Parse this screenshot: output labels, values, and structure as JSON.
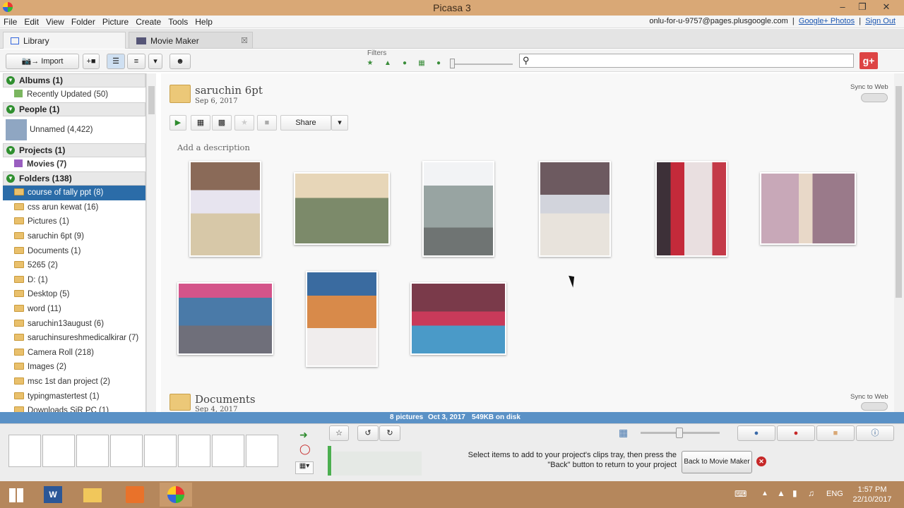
{
  "window": {
    "title": "Picasa 3"
  },
  "menu": [
    "File",
    "Edit",
    "View",
    "Folder",
    "Picture",
    "Create",
    "Tools",
    "Help"
  ],
  "account": {
    "email": "onlu-for-u-9757@pages.plusgoogle.com",
    "photos_link": "Google+ Photos",
    "signout": "Sign Out"
  },
  "tabs": {
    "library": "Library",
    "movie_maker": "Movie Maker"
  },
  "toolbar": {
    "import": "Import",
    "filters_label": "Filters"
  },
  "sidebar": {
    "albums": "Albums (1)",
    "recently_updated": "Recently Updated (50)",
    "people": "People (1)",
    "unnamed": "Unnamed (4,422)",
    "projects": "Projects (1)",
    "movies": "Movies (7)",
    "folders": "Folders (138)",
    "folder_items": [
      "course of tally ppt (8)",
      "css arun kewat (16)",
      "Pictures (1)",
      "saruchin 6pt (9)",
      "Documents (1)",
      "5265 (2)",
      "D: (1)",
      "Desktop (5)",
      "word (11)",
      "saruchin13august (6)",
      "saruchinsureshmedicalkirar (7)",
      "Camera Roll (218)",
      "Images (2)",
      "msc 1st dan project (2)",
      "typingmastertest (1)",
      "Downloads SiR PC (1)"
    ]
  },
  "album": {
    "title": "saruchin 6pt",
    "date": "Sep 6, 2017",
    "sync": "Sync to Web",
    "share": "Share",
    "description": "Add a description"
  },
  "next_album": {
    "title": "Documents",
    "date": "Sep 4, 2017",
    "sync": "Sync to Web"
  },
  "status": {
    "pictures": "8 pictures",
    "date": "Oct 3, 2017",
    "size": "549KB on disk"
  },
  "tray": {
    "message": "Select items to add to your project's clips tray, then press the \"Back\" button to return to your project",
    "back_button": "Back to Movie Maker"
  },
  "taskbar": {
    "lang": "ENG",
    "time": "1:57 PM",
    "date": "22/10/2017"
  },
  "colors": {
    "accent": "#2b6ca8",
    "status_bar": "#5a91c6",
    "title_bar": "#d9a876",
    "taskbar": "#b5875c"
  }
}
